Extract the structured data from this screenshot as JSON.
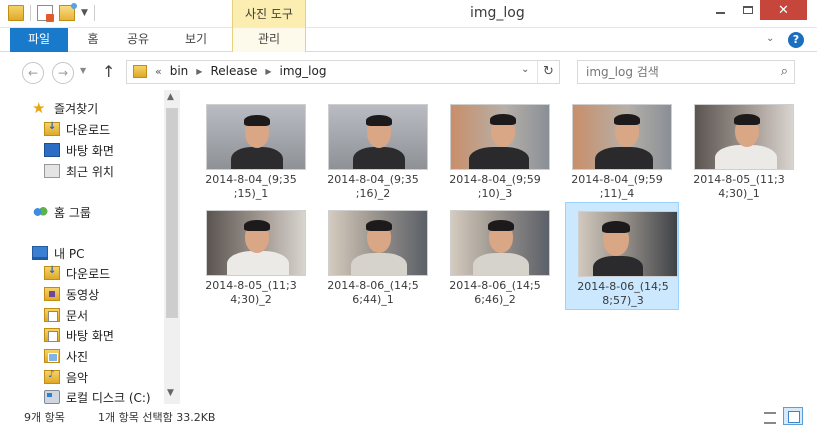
{
  "window": {
    "title": "img_log",
    "contextual_tab_group": "사진 도구",
    "close_glyph": "✕"
  },
  "ribbon": {
    "tabs": [
      "파일",
      "홈",
      "공유",
      "보기",
      "관리"
    ],
    "chevron": "⌄",
    "help": "?"
  },
  "address": {
    "prefix": "«",
    "crumbs": [
      "bin",
      "Release",
      "img_log"
    ],
    "search_placeholder": "img_log 검색"
  },
  "nav_pane": {
    "items": [
      {
        "label": "즐겨찾기",
        "icon": "star-icon"
      },
      {
        "label": "다운로드",
        "icon": "downloads-folder-icon"
      },
      {
        "label": "바탕 화면",
        "icon": "desktop-icon"
      },
      {
        "label": "최근 위치",
        "icon": "recent-places-icon"
      },
      {
        "label": "홈 그룹",
        "icon": "homegroup-icon"
      },
      {
        "label": "내 PC",
        "icon": "computer-icon"
      },
      {
        "label": "다운로드",
        "icon": "downloads-folder-icon"
      },
      {
        "label": "동영상",
        "icon": "videos-folder-icon"
      },
      {
        "label": "문서",
        "icon": "documents-folder-icon"
      },
      {
        "label": "바탕 화면",
        "icon": "desktop-folder-icon"
      },
      {
        "label": "사진",
        "icon": "pictures-folder-icon"
      },
      {
        "label": "음악",
        "icon": "music-folder-icon"
      },
      {
        "label": "로컬 디스크 (C:)",
        "icon": "local-disk-icon"
      }
    ]
  },
  "files": [
    {
      "line1": "2014-8-04_(9;35",
      "line2": ";15)_1",
      "selected": false
    },
    {
      "line1": "2014-8-04_(9;35",
      "line2": ";16)_2",
      "selected": false
    },
    {
      "line1": "2014-8-04_(9;59",
      "line2": ";10)_3",
      "selected": false
    },
    {
      "line1": "2014-8-04_(9;59",
      "line2": ";11)_4",
      "selected": false
    },
    {
      "line1": "2014-8-05_(11;3",
      "line2": "4;30)_1",
      "selected": false
    },
    {
      "line1": "2014-8-05_(11;3",
      "line2": "4;30)_2",
      "selected": false
    },
    {
      "line1": "2014-8-06_(14;5",
      "line2": "6;44)_1",
      "selected": false
    },
    {
      "line1": "2014-8-06_(14;5",
      "line2": "6;46)_2",
      "selected": false
    },
    {
      "line1": "2014-8-06_(14;5",
      "line2": "8;57)_3",
      "selected": true
    }
  ],
  "status": {
    "item_count": "9개 항목",
    "selection": "1개 항목 선택함 33.2KB"
  },
  "colors": {
    "file_tab": "#1979ca",
    "contextual_tab": "#fbeeb0",
    "close_button": "#c7463c",
    "selection_bg": "#cce8ff"
  }
}
